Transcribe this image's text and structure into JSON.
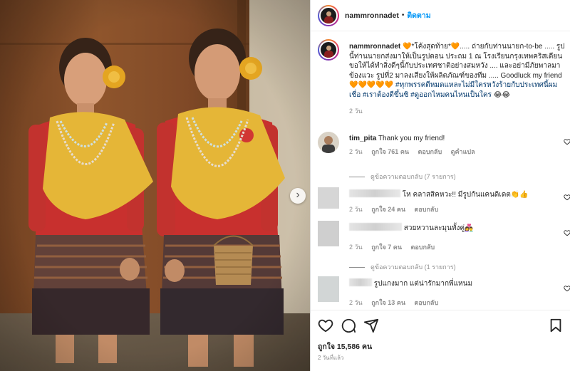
{
  "post": {
    "username": "nammronnadet",
    "follow_label": "ติดตาม",
    "dot": "•",
    "caption": {
      "segments": [
        {
          "text": "nammronnadet",
          "style": "bold"
        },
        {
          "text": " 🧡*โค้งสุดท้าย*🧡..... ถ่ายกับท่านนายก-to-be ..... รูปนี้ท่านนายกส่งมาให้เป็นรูปตอน ประถม 1 ณ โรงเรียนกรุงเทพคริสเตียน ขอให้ได้ทำสิ่งดีๆนี้กับประเทศชาติอย่างสมหวัง .... และอย่ามีภัยพาลมาข้องแวะ รูปที่2 มาลงเสียงให้ผลิตภัณฑ์ของทีม ..... Goodluck my friend 🧡🧡🧡🧡🧡 ",
          "style": "plain"
        },
        {
          "text": "#ทุกพรรคดีหมดแหละไม่มีใครหวังร้ายกับประเทศนี้ผมเชื่อ #เราต้องดีขึ้นซิ #ดูออกไหมคนไหนเป็นใคร",
          "style": "tag"
        },
        {
          "text": " 😂😂",
          "style": "plain"
        }
      ],
      "time": "2 วัน"
    },
    "comments": [
      {
        "username": "tim_pita",
        "text": "Thank you my friend!",
        "time": "2 วัน",
        "likes": "ถูกใจ 761 คน",
        "reply": "ตอบกลับ",
        "extra": "ดูคำแปล",
        "view_replies": "ดูข้อความตอบกลับ (7 รายการ)"
      },
      {
        "username": "",
        "text": "โห คลาสสิคหวะ!! มีรูปกันแคนดิเดต👏👍",
        "time": "2 วัน",
        "likes": "ถูกใจ 24 คน",
        "reply": "ตอบกลับ"
      },
      {
        "username": "",
        "text": "สวยหวานละมุนทั้งคู่👩‍❤️‍👨",
        "time": "2 วัน",
        "likes": "ถูกใจ 7 คน",
        "reply": "ตอบกลับ",
        "view_replies": "ดูข้อความตอบกลับ (1 รายการ)"
      },
      {
        "username": "",
        "text": "รูปแกงมาก แต่น่ารักมากพี่แหนม",
        "time": "2 วัน",
        "likes": "ถูกใจ 13 คน",
        "reply": "ตอบกลับ"
      }
    ],
    "likes_total": "ถูกใจ 15,586 คน",
    "posted": "2 วันที่แล้ว",
    "colors": {
      "link": "#0095f6",
      "hashtag": "#00376b",
      "muted": "#8e8e8e",
      "text": "#262626"
    },
    "icons": [
      "heart-icon",
      "comment-icon",
      "share-icon",
      "bookmark-icon",
      "chevron-right-icon"
    ]
  }
}
